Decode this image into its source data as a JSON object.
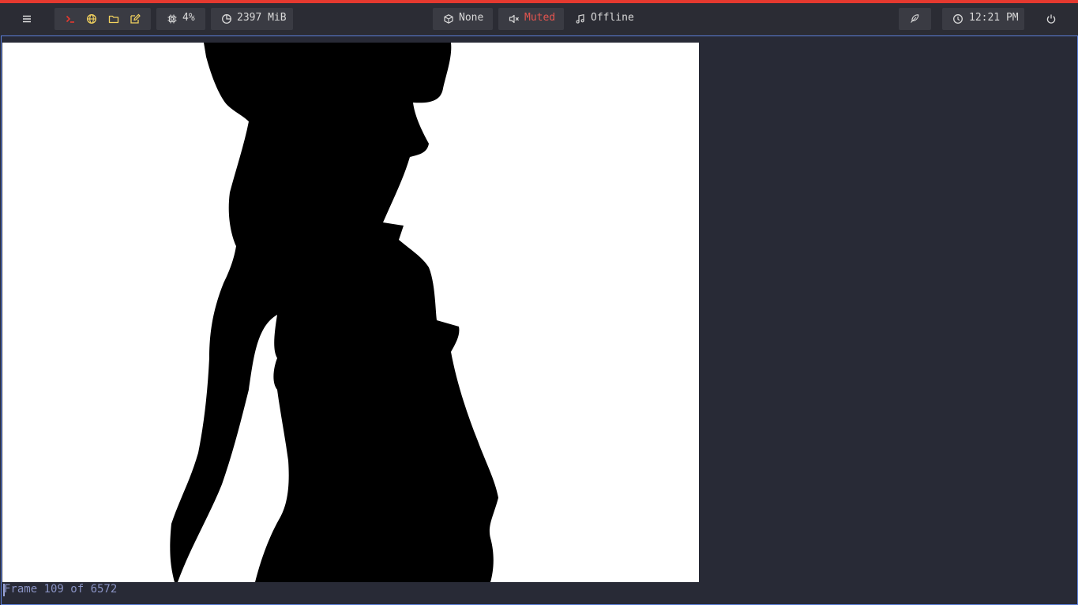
{
  "topbar": {
    "accent_color": "#e5392f",
    "menu_icon": "hamburger-menu-icon",
    "launchers": [
      {
        "name": "terminal",
        "icon": "terminal-icon",
        "color": "#e5392f"
      },
      {
        "name": "browser",
        "icon": "globe-icon",
        "color": "#f4d35e"
      },
      {
        "name": "files",
        "icon": "folder-icon",
        "color": "#f4d35e"
      },
      {
        "name": "editor",
        "icon": "edit-icon",
        "color": "#f4d35e"
      }
    ],
    "cpu": {
      "icon": "cpu-icon",
      "value": "4%"
    },
    "memory": {
      "icon": "memory-pie-icon",
      "value": "2397 MiB"
    },
    "package": {
      "icon": "package-icon",
      "value": "None"
    },
    "volume": {
      "icon": "speaker-muted-icon",
      "value": "Muted",
      "color": "#e5554f"
    },
    "music": {
      "icon": "music-note-icon",
      "value": "Offline"
    },
    "theme": {
      "icon": "feather-icon"
    },
    "clock": {
      "icon": "clock-icon",
      "value": "12:21 PM"
    },
    "power": {
      "icon": "power-icon"
    }
  },
  "viewer": {
    "image": "black silhouette of a person on white background",
    "status_text": "Frame 109 of 6572"
  }
}
